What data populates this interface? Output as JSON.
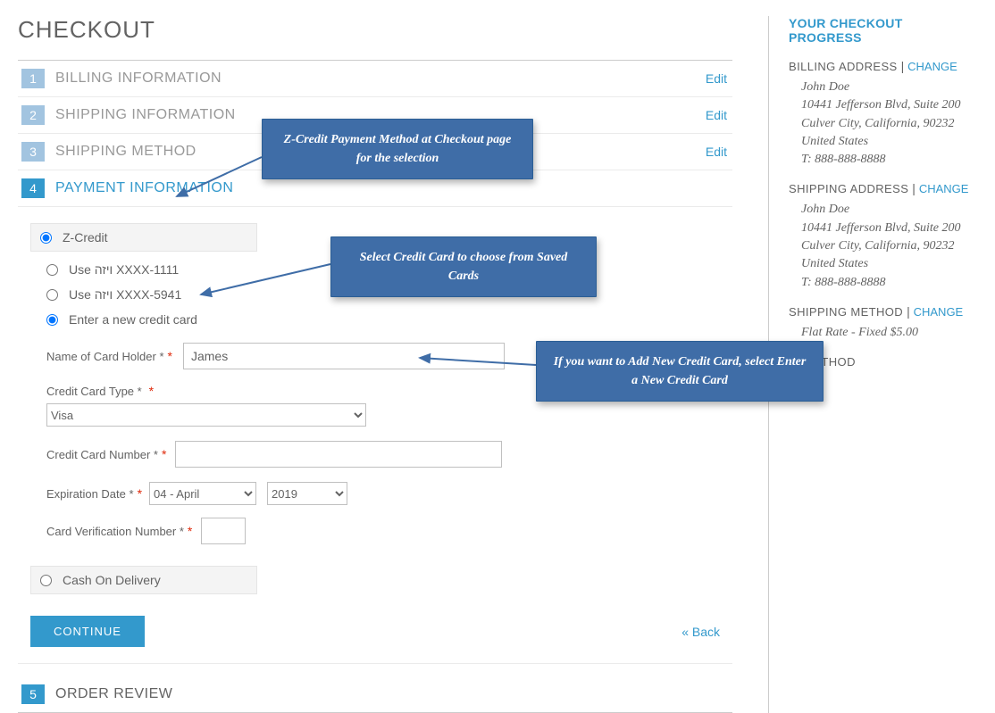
{
  "page_title": "CHECKOUT",
  "steps": [
    {
      "num": "1",
      "title": "BILLING INFORMATION",
      "edit": "Edit"
    },
    {
      "num": "2",
      "title": "SHIPPING INFORMATION",
      "edit": "Edit"
    },
    {
      "num": "3",
      "title": "SHIPPING METHOD",
      "edit": "Edit"
    },
    {
      "num": "4",
      "title": "PAYMENT INFORMATION"
    },
    {
      "num": "5",
      "title": "ORDER REVIEW"
    }
  ],
  "payment": {
    "zcredit_label": "Z-Credit",
    "saved": [
      "Use ויזה XXXX-1111",
      "Use ויזה XXXX-5941"
    ],
    "new_card_label": "Enter a new credit card",
    "fields": {
      "name_label": "Name of Card Holder *",
      "name_value": "James",
      "type_label": "Credit Card Type *",
      "type_value": "Visa",
      "number_label": "Credit Card Number *",
      "number_value": "",
      "exp_label": "Expiration Date *",
      "exp_month": "04 - April",
      "exp_year": "2019",
      "cvv_label": "Card Verification Number *",
      "cvv_value": ""
    },
    "cod_label": "Cash On Delivery"
  },
  "actions": {
    "continue": "CONTINUE",
    "back": "« Back"
  },
  "sidebar": {
    "title": "YOUR CHECKOUT PROGRESS",
    "billing": {
      "label": "BILLING ADDRESS ",
      "change": "CHANGE"
    },
    "shipping_addr": {
      "label": "SHIPPING ADDRESS ",
      "change": "CHANGE"
    },
    "shipping_method": {
      "label": "SHIPPING METHOD ",
      "change": "CHANGE",
      "value": "Flat Rate - Fixed $5.00"
    },
    "payment_method": {
      "label": "IT METHOD"
    },
    "address": {
      "name": "John Doe",
      "street": "10441 Jefferson Blvd, Suite 200",
      "city": "Culver City, California, 90232",
      "country": "United States",
      "phone": "T: 888-888-8888"
    }
  },
  "callouts": {
    "c1": "Z-Credit Payment Method at Checkout page for the selection",
    "c2": "Select Credit Card to choose from Saved Cards",
    "c3": "If you want to Add New Credit Card, select Enter a New Credit Card"
  }
}
